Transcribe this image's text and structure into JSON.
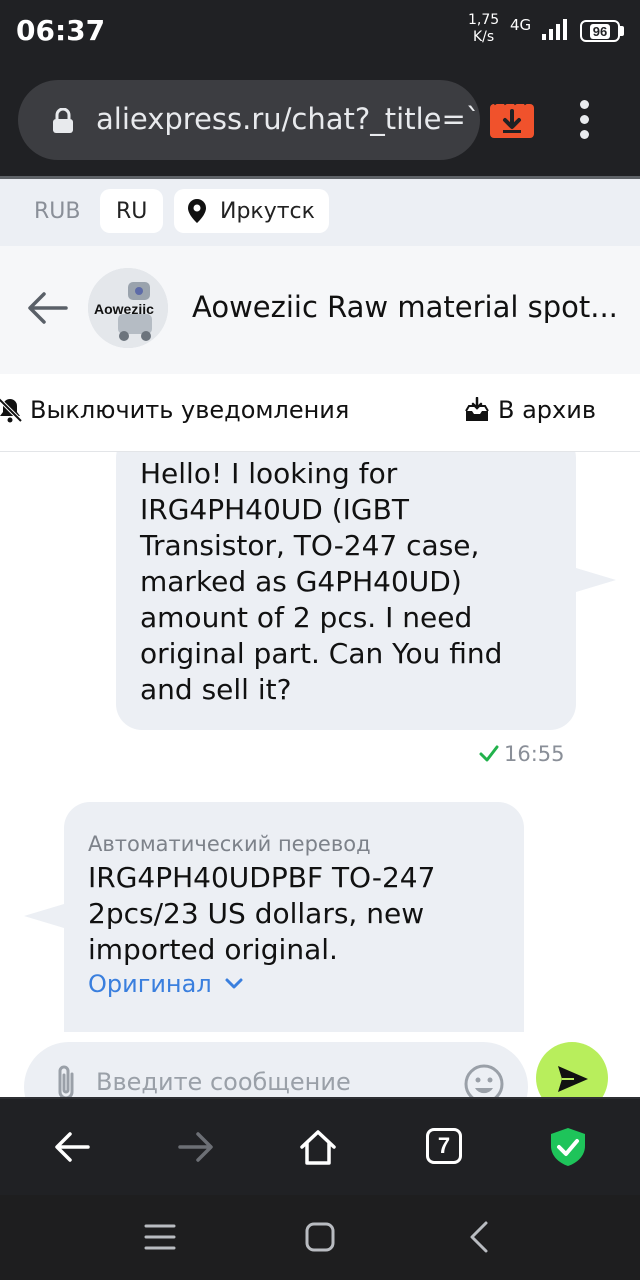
{
  "status_bar": {
    "time": "06:37",
    "net_speed_value": "1,75",
    "net_speed_unit": "K/s",
    "network": "4G",
    "battery": "96"
  },
  "browser": {
    "url": "aliexpress.ru/chat?_title=`",
    "tabs_count": "7"
  },
  "region": {
    "currency": "RUB",
    "language": "RU",
    "city": "Иркутск"
  },
  "chat_header": {
    "title": "Aoweziic Raw material spot...",
    "avatar_text": "Aoweziic"
  },
  "actions": {
    "mute_label": "Выключить уведомления",
    "archive_label": "В архив"
  },
  "messages": {
    "outgoing": {
      "text": "Hello! I looking for IRG4PH40UD (IGBT Transistor, TO-247 case, marked as G4PH40UD) amount of 2 pcs. I need original part. Can You find and sell it?",
      "time": "16:55"
    },
    "incoming": {
      "translation_label": "Автоматический перевод",
      "text": "IRG4PH40UDPBF TO-247 2pcs/23 US dollars, new imported original.",
      "original_link": "Оригинал"
    }
  },
  "composer": {
    "placeholder": "Введите сообщение"
  },
  "colors": {
    "accent_green": "#b8ee5c",
    "link_blue": "#3a7fde",
    "read_check": "#22b24c",
    "download_orange": "#f0522c",
    "shield_green": "#1ec45a"
  }
}
